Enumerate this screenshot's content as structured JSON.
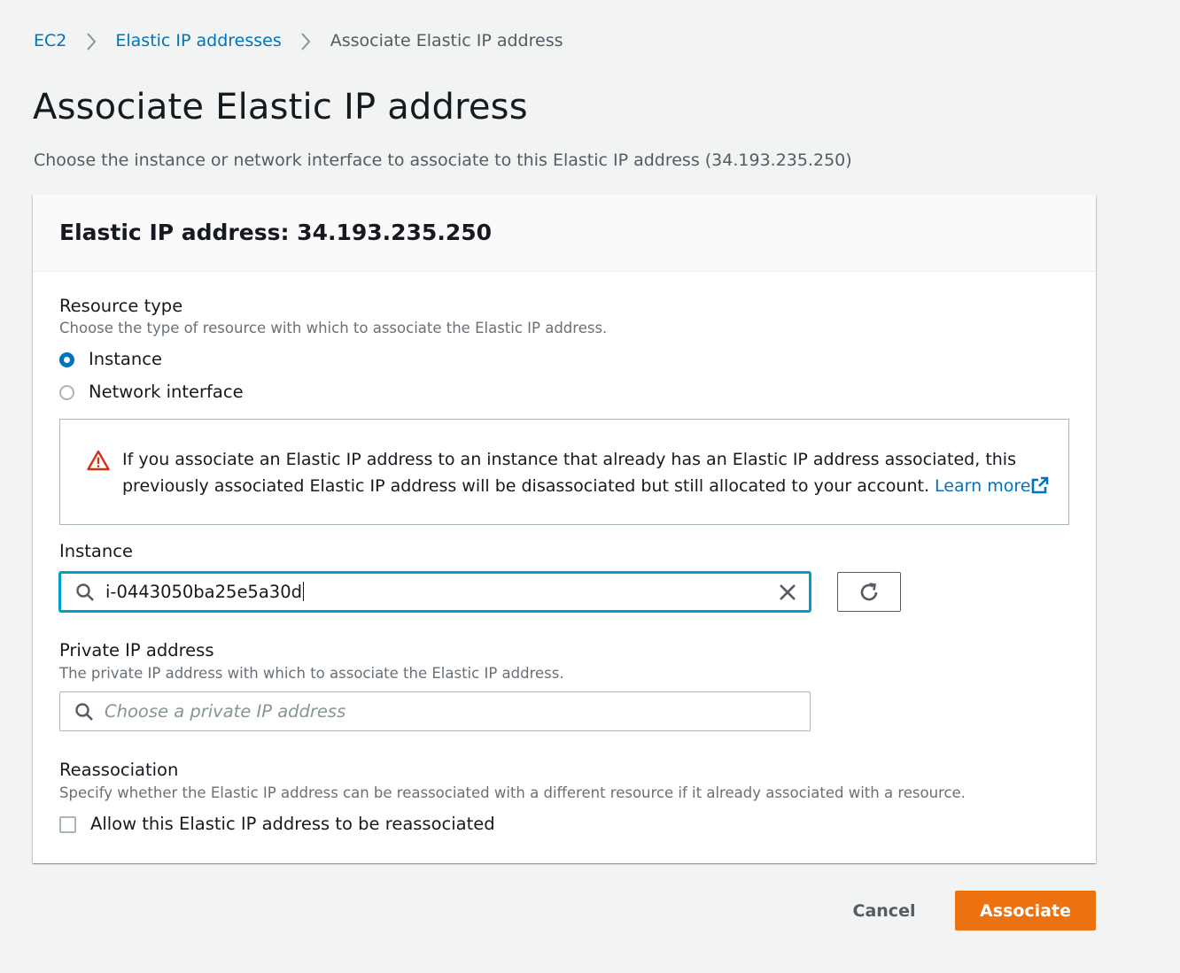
{
  "breadcrumb": {
    "items": [
      "EC2",
      "Elastic IP addresses"
    ],
    "current": "Associate Elastic IP address"
  },
  "page": {
    "title": "Associate Elastic IP address",
    "description": "Choose the instance or network interface to associate to this Elastic IP address (34.193.235.250)"
  },
  "panel": {
    "title": "Elastic IP address: 34.193.235.250",
    "resource_type": {
      "label": "Resource type",
      "description": "Choose the type of resource with which to associate the Elastic IP address.",
      "options": [
        {
          "label": "Instance",
          "selected": true
        },
        {
          "label": "Network interface",
          "selected": false
        }
      ]
    },
    "alert": {
      "icon": "warning-icon",
      "text": "If you associate an Elastic IP address to an instance that already has an Elastic IP address associated, this previously associated Elastic IP address will be disassociated but still allocated to your account.",
      "link": "Learn more"
    },
    "instance": {
      "label": "Instance",
      "value": "i-0443050ba25e5a30d"
    },
    "private_ip": {
      "label": "Private IP address",
      "description": "The private IP address with which to associate the Elastic IP address.",
      "placeholder": "Choose a private IP address"
    },
    "reassociation": {
      "label": "Reassociation",
      "description": "Specify whether the Elastic IP address can be reassociated with a different resource if it already associated with a resource.",
      "checkbox_label": "Allow this Elastic IP address to be reassociated",
      "checked": false
    }
  },
  "actions": {
    "cancel": "Cancel",
    "primary": "Associate"
  },
  "colors": {
    "link": "#0073bb",
    "primary_button": "#ec7211",
    "focus": "#00a1c9",
    "warning": "#d13212"
  }
}
